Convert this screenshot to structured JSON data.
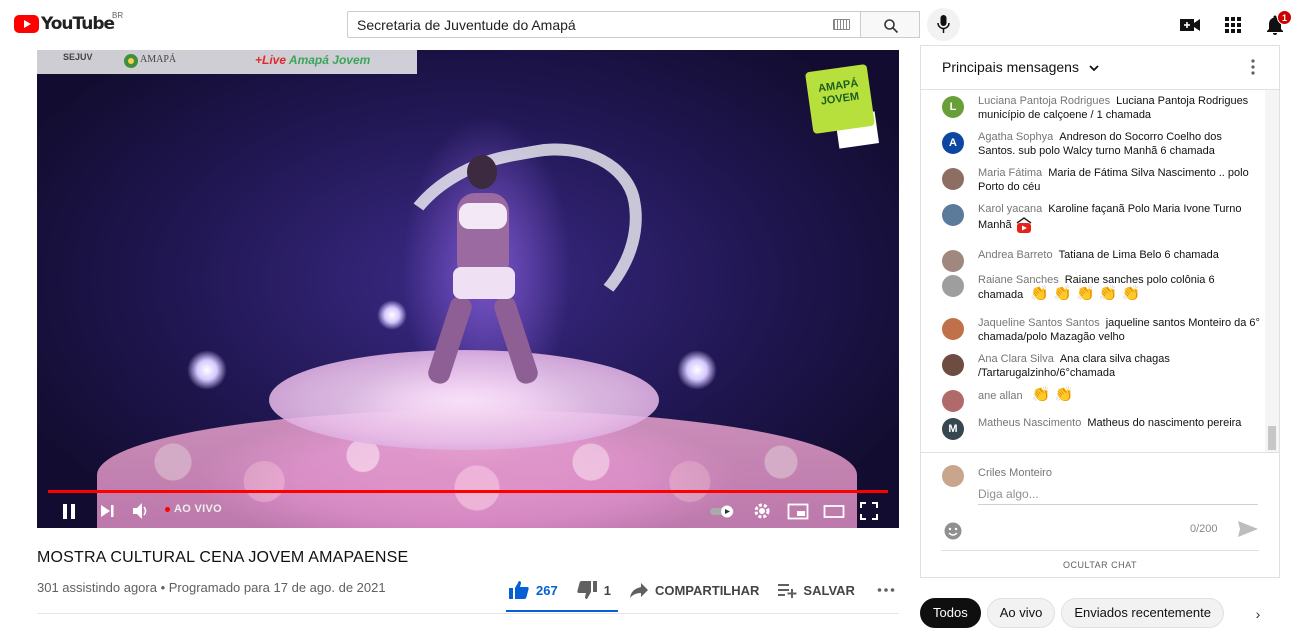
{
  "header": {
    "logo_text": "YouTube",
    "country_code": "BR",
    "search_value": "Secretaria de Juventude do Amapá",
    "notification_count": "1"
  },
  "video": {
    "overlay": {
      "sejuv": "SEJUV",
      "amapa": "AMAPÁ",
      "live_prefix": "+Live",
      "live_name": "Amapá Jovem",
      "badge": "AMAPÁ JOVEM"
    },
    "live_label": "AO VIVO",
    "title": "MOSTRA CULTURAL CENA JOVEM AMAPAENSE",
    "meta": "301 assistindo agora • Programado para 17 de ago. de 2021",
    "actions": {
      "likes": "267",
      "dislikes": "1",
      "share": "COMPARTILHAR",
      "save": "SALVAR"
    }
  },
  "chat": {
    "header_title": "Principais mensagens",
    "messages": [
      {
        "initial": "L",
        "color": "#689f38",
        "author": "Luciana Pantoja Rodrigues",
        "text": "Luciana Pantoja Rodrigues município de calçoene / 1 chamada"
      },
      {
        "initial": "A",
        "color": "#0d47a1",
        "author": "Agatha Sophya",
        "text": "Andreson do Socorro Coelho dos Santos. sub polo Walcy turno Manhã 6 chamada"
      },
      {
        "initial": "",
        "color": "#8d6e63",
        "author": "Maria Fátima",
        "text": "Maria de Fátima Silva Nascimento .. polo Porto do céu"
      },
      {
        "initial": "",
        "color": "#5c7a9a",
        "author": "Karol yacana",
        "text": "Karoline façanã Polo Maria Ivone Turno Manhã"
      },
      {
        "initial": "",
        "color": "#a1887f",
        "author": "Andrea Barreto",
        "text": "Tatiana de Lima Belo 6 chamada"
      },
      {
        "initial": "",
        "color": "#9e9e9e",
        "author": "Raiane Sanches",
        "text": "Raiane sanches polo colônia 6 chamada"
      },
      {
        "initial": "",
        "color": "#c0704a",
        "author": "Jaqueline Santos Santos",
        "text": "jaqueline santos Monteiro da 6° chamada/polo Mazagão velho"
      },
      {
        "initial": "",
        "color": "#6d4c41",
        "author": "Ana Clara Silva",
        "text": "Ana clara silva chagas /Tartarugalzinho/6°chamada"
      },
      {
        "initial": "",
        "color": "#b06a6a",
        "author": "ane allan",
        "text": ""
      },
      {
        "initial": "M",
        "color": "#37474f",
        "author": "Matheus Nascimento",
        "text": "Matheus do nascimento pereira"
      }
    ],
    "input": {
      "user_name": "Criles Monteiro",
      "placeholder": "Diga algo...",
      "counter": "0/200"
    },
    "footer": "OCULTAR CHAT"
  },
  "chips": [
    "Todos",
    "Ao vivo",
    "Enviados recentemente"
  ]
}
